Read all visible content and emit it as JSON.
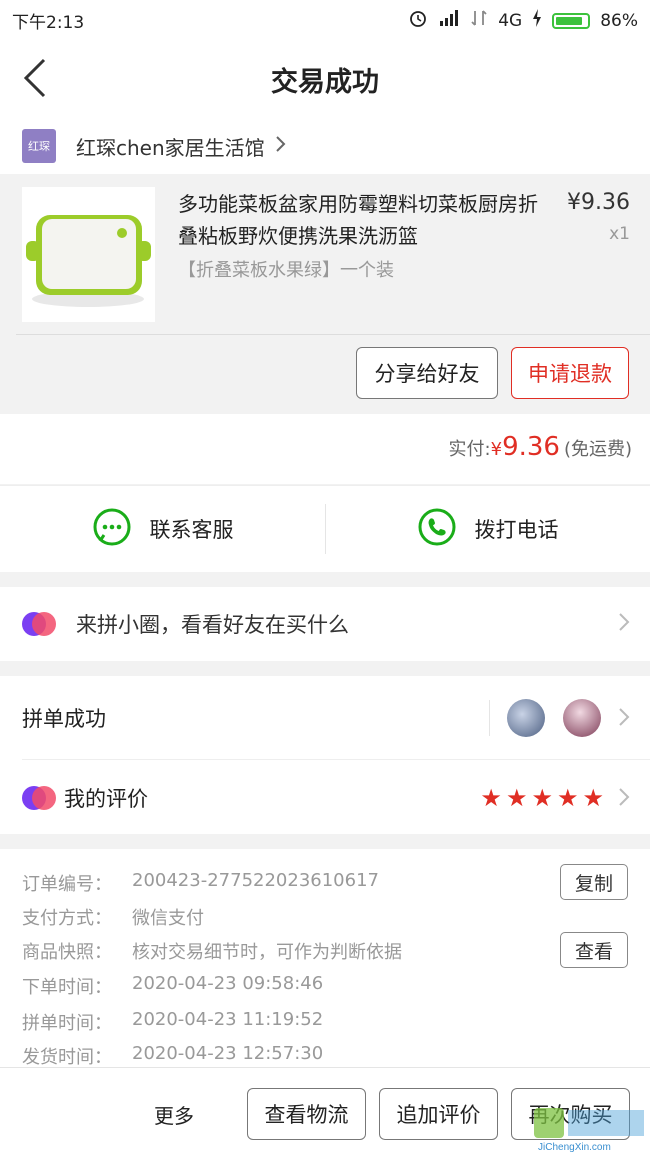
{
  "status_bar": {
    "time": "下午2:13",
    "network": "4G",
    "battery": "86%",
    "battery_level": 0.86
  },
  "header": {
    "title": "交易成功"
  },
  "shop": {
    "logo_text": "红琛",
    "name": "红琛chen家居生活馆"
  },
  "product": {
    "title": "多功能菜板盆家用防霉塑料切菜板厨房折叠粘板野炊便携洗果洗沥篮",
    "price": "¥9.36",
    "quantity": "x1",
    "spec": "【折叠菜板水果绿】一个装",
    "share_label": "分享给好友",
    "refund_label": "申请退款"
  },
  "payment": {
    "label": "实付:",
    "currency": "¥",
    "amount": "9.36",
    "shipping": "(免运费)"
  },
  "contact": {
    "service_label": "联系客服",
    "phone_label": "拨打电话"
  },
  "circle": {
    "label": "来拼小圈，看看好友在买什么"
  },
  "group": {
    "success_label": "拼单成功",
    "review_label": "我的评价",
    "rating": 5
  },
  "order_info": {
    "rows": [
      {
        "key": "订单编号：",
        "value": "200423-277522023610617"
      },
      {
        "key": "支付方式：",
        "value": "微信支付"
      },
      {
        "key": "商品快照：",
        "value": "核对交易细节时，可作为判断依据"
      },
      {
        "key": "下单时间：",
        "value": "2020-04-23 09:58:46"
      },
      {
        "key": "拼单时间：",
        "value": "2020-04-23 11:19:52"
      },
      {
        "key": "发货时间：",
        "value": "2020-04-23 12:57:30"
      }
    ],
    "copy_label": "复制",
    "view_label": "查看"
  },
  "bottom_bar": {
    "more_label": "更多",
    "logistics_label": "查看物流",
    "add_review_label": "追加评价",
    "rebuy_label": "再次购买"
  },
  "watermark": {
    "text": "JiChengXin.com"
  },
  "colors": {
    "accent": "#e02e24",
    "wechat_green": "#1aad19"
  }
}
